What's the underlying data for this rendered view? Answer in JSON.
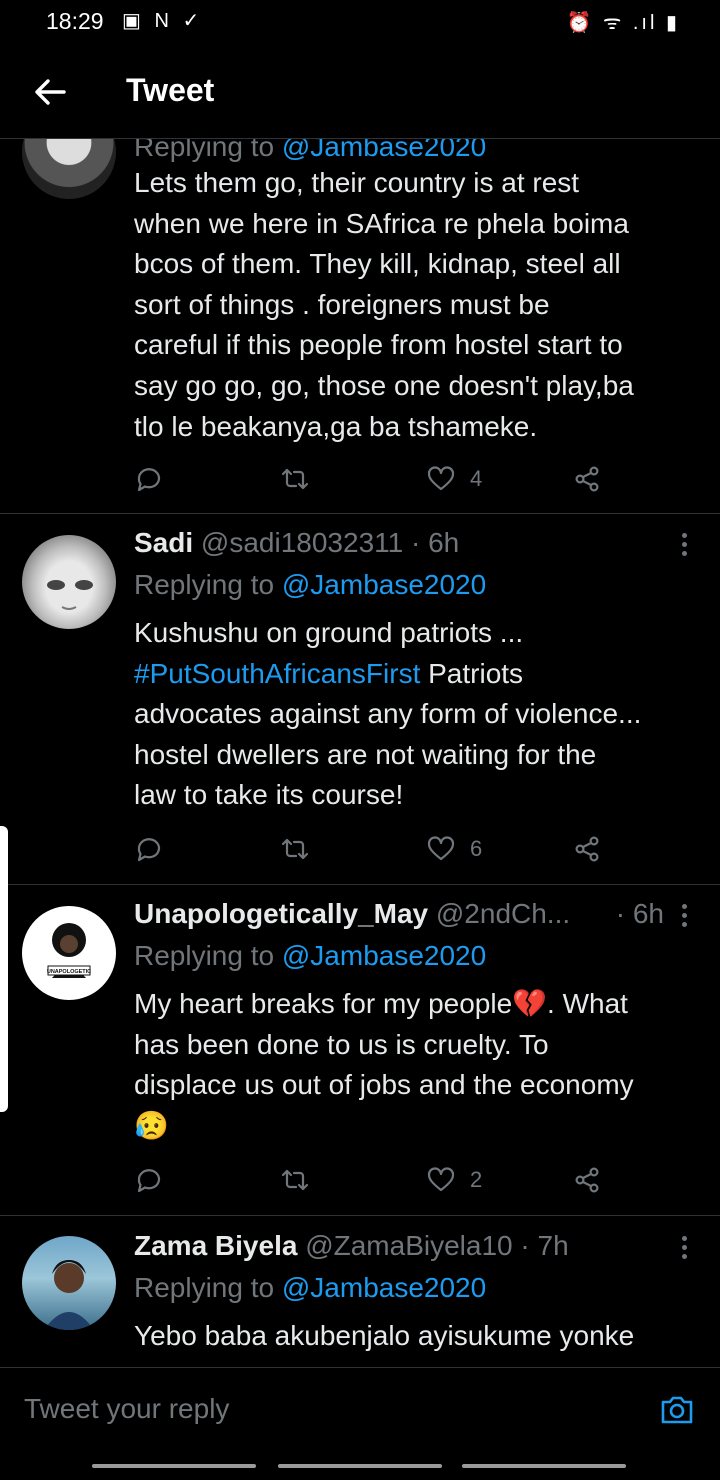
{
  "status_bar": {
    "time": "18:29",
    "left_icons": "▣ N ✓",
    "right_icons": "⏰ ᯤ .ıl ▮"
  },
  "app_bar": {
    "title": "Tweet"
  },
  "partial_tweet": {
    "replying_prefix": "Replying to",
    "replying_to": "@Jambase2020",
    "lines": [
      "Lets them go,  their country is at rest",
      "when we here in SAfrica re phela boima",
      "bcos of them.  They kill, kidnap, steel all",
      "sort of things .   foreigners must be",
      "careful if this people from hostel  start to",
      "say go go, go, those one doesn't play,ba",
      "tlo le beakanya,ga ba tshameke."
    ],
    "likes": "4"
  },
  "tweets": [
    {
      "name": "Sadi",
      "handle": "@sadi18032311",
      "time": "· 6h",
      "replying_prefix": "Replying to",
      "replying_to": "@Jambase2020",
      "line1": "Kushushu on ground patriots ...",
      "hashtag": "#PutSouthAfricansFirst",
      "line2_rest": " Patriots",
      "line3": "advocates against any form of violence...",
      "line4": "hostel dwellers are not waiting for the",
      "line5": "law to take its course!",
      "likes": "6"
    },
    {
      "name": "Unapologetically_May",
      "handle": "@2ndCh...",
      "time": "· 6h",
      "replying_prefix": "Replying to",
      "replying_to": "@Jambase2020",
      "line1": "My heart breaks for my people💔. What",
      "line2": "has been done to us is cruelty. To",
      "line3": "displace us out of jobs and the economy",
      "line4": "😥",
      "avatar_text": "UNAPOLOGETIC",
      "likes": "2"
    },
    {
      "name": "Zama Biyela",
      "handle": "@ZamaBiyela10",
      "time": "· 7h",
      "replying_prefix": "Replying to",
      "replying_to": "@Jambase2020",
      "line1": "Yebo baba  akubenjalo ayisukume  yonke"
    }
  ],
  "composer": {
    "placeholder": "Tweet your reply"
  },
  "colors": {
    "background": "#000000",
    "text": "#e7e9ea",
    "muted": "#71767b",
    "link": "#1d9bf0",
    "divider": "#2f3336"
  },
  "icons": [
    "back-arrow-icon",
    "more-options-icon",
    "reply-icon",
    "retweet-icon",
    "like-icon",
    "share-icon",
    "camera-icon"
  ]
}
